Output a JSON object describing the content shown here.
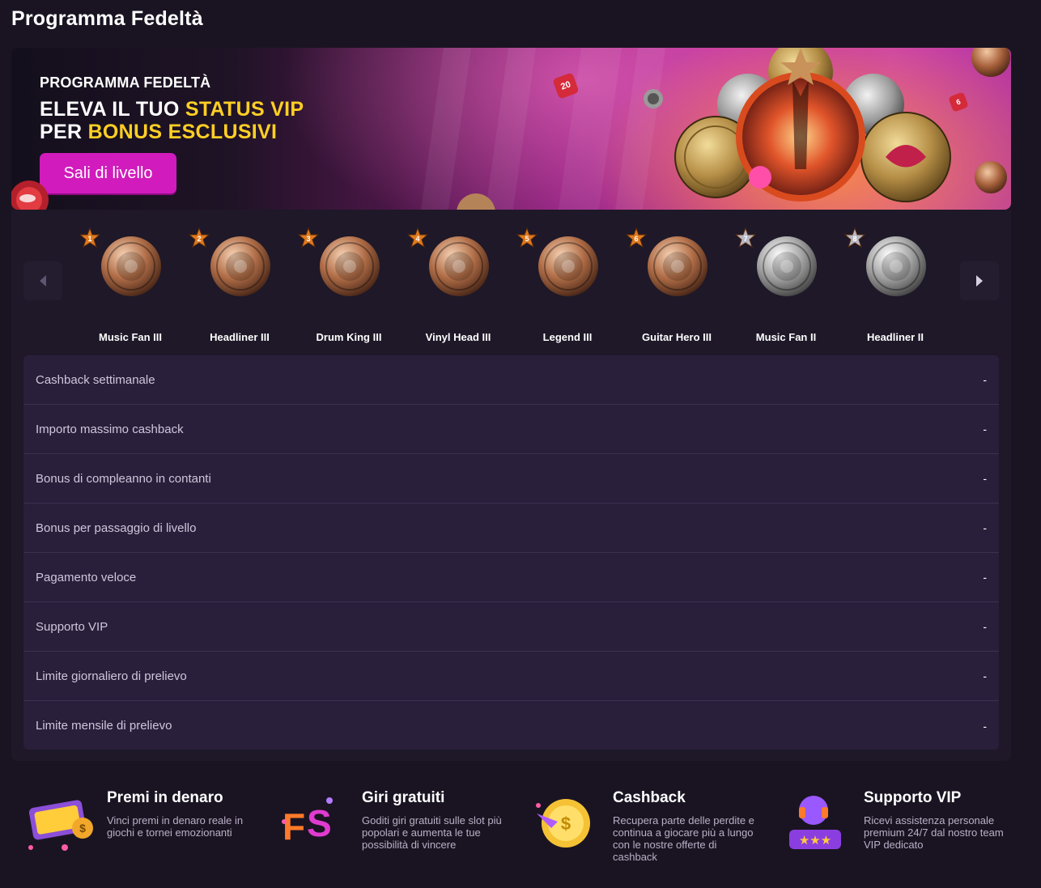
{
  "page": {
    "title": "Programma Fedeltà"
  },
  "banner": {
    "kicker": "PROGRAMMA FEDELTÀ",
    "line1_prefix": "ELEVA IL TUO ",
    "line1_highlight": "STATUS VIP",
    "line2_prefix": "PER ",
    "line2_highlight": "BONUS ESCLUSIVI",
    "cta_label": "Sali di livello",
    "deco_badges": [
      "20",
      "6"
    ],
    "colors": {
      "highlight": "#ffcf24",
      "cta": "#d11bbd"
    }
  },
  "levels": [
    {
      "number": "1",
      "name": "Music Fan III",
      "tier": "bronze",
      "icon": "crossed-guitars-icon"
    },
    {
      "number": "2",
      "name": "Headliner III",
      "tier": "bronze",
      "icon": "microphone-icon"
    },
    {
      "number": "3",
      "name": "Drum King III",
      "tier": "bronze",
      "icon": "drum-icon"
    },
    {
      "number": "4",
      "name": "Vinyl Head III",
      "tier": "bronze",
      "icon": "vinyl-icon"
    },
    {
      "number": "5",
      "name": "Legend III",
      "tier": "bronze",
      "icon": "skull-icon"
    },
    {
      "number": "6",
      "name": "Guitar Hero III",
      "tier": "bronze",
      "icon": "rock-hand-icon"
    },
    {
      "number": "7",
      "name": "Music Fan II",
      "tier": "silver",
      "icon": "crossed-guitars-icon"
    },
    {
      "number": "8",
      "name": "Headliner II",
      "tier": "silver",
      "icon": "microphone-icon"
    }
  ],
  "benefits": [
    {
      "label": "Cashback settimanale",
      "value": "-"
    },
    {
      "label": "Importo massimo cashback",
      "value": "-"
    },
    {
      "label": "Bonus di compleanno in contanti",
      "value": "-"
    },
    {
      "label": "Bonus per passaggio di livello",
      "value": "-"
    },
    {
      "label": "Pagamento veloce",
      "value": "-"
    },
    {
      "label": "Supporto VIP",
      "value": "-"
    },
    {
      "label": "Limite giornaliero di prelievo",
      "value": "-"
    },
    {
      "label": "Limite mensile di prelievo",
      "value": "-"
    }
  ],
  "features": [
    {
      "title": "Premi in denaro",
      "description": "Vinci premi in denaro reale in giochi e tornei emozionanti",
      "icon": "cash-icon"
    },
    {
      "title": "Giri gratuiti",
      "description": "Goditi giri gratuiti sulle slot più popolari e aumenta le tue possibilità di vincere",
      "icon": "free-spins-icon"
    },
    {
      "title": "Cashback",
      "description": "Recupera parte delle perdite e continua a giocare più a lungo con le nostre offerte di cashback",
      "icon": "cashback-coin-icon"
    },
    {
      "title": "Supporto VIP",
      "description": "Ricevi assistenza personale premium 24/7 dal nostro team VIP dedicato",
      "icon": "vip-support-icon"
    }
  ]
}
